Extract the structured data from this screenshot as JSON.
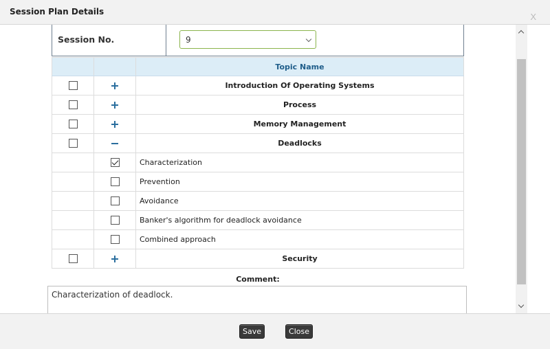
{
  "dialog": {
    "title": "Session Plan Details",
    "close_label": "X"
  },
  "session": {
    "label": "Session No.",
    "value": "9"
  },
  "table": {
    "header": "Topic Name",
    "rows": [
      {
        "kind": "topic",
        "label": "Introduction Of Operating Systems",
        "expanded": false,
        "checked": false
      },
      {
        "kind": "topic",
        "label": "Process",
        "expanded": false,
        "checked": false
      },
      {
        "kind": "topic",
        "label": "Memory Management",
        "expanded": false,
        "checked": false
      },
      {
        "kind": "topic",
        "label": "Deadlocks",
        "expanded": true,
        "checked": false
      },
      {
        "kind": "subtopic",
        "label": "Characterization",
        "checked": true
      },
      {
        "kind": "subtopic",
        "label": "Prevention",
        "checked": false
      },
      {
        "kind": "subtopic",
        "label": "Avoidance",
        "checked": false
      },
      {
        "kind": "subtopic",
        "label": "Banker's algorithm for deadlock avoidance",
        "checked": false
      },
      {
        "kind": "subtopic",
        "label": "Combined approach",
        "checked": false
      },
      {
        "kind": "topic",
        "label": "Security",
        "expanded": false,
        "checked": false
      }
    ]
  },
  "comment": {
    "label": "Comment:",
    "value": "Characterization of deadlock."
  },
  "footer": {
    "save_label": "Save",
    "close_label": "Close"
  }
}
